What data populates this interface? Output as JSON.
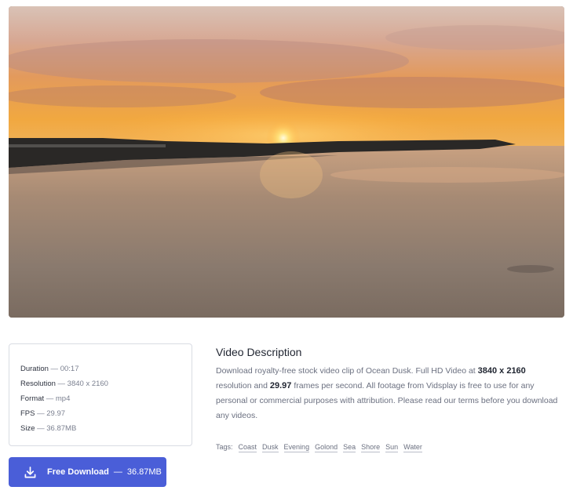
{
  "video": {
    "title": "Ocean Dusk"
  },
  "meta": [
    {
      "key": "Duration",
      "value": "00:17"
    },
    {
      "key": "Resolution",
      "value": "3840 x 2160"
    },
    {
      "key": "Format",
      "value": "mp4"
    },
    {
      "key": "FPS",
      "value": "29.97"
    },
    {
      "key": "Size",
      "value": "36.87MB"
    }
  ],
  "meta_sep": " — ",
  "download": {
    "label": "Free Download",
    "sep": "—",
    "size": "36.87MB"
  },
  "description": {
    "title": "Video Description",
    "part1": "Download royalty-free stock video clip of Ocean Dusk. Full HD Video at ",
    "resolution": "3840 x 2160",
    "part2": " resolution and ",
    "fps": "29.97",
    "part3": " frames per second. All footage from Vidsplay is free to use for any personal or commercial purposes with attribution. Please read our terms before you download any videos."
  },
  "tags": {
    "label": "Tags:",
    "items": [
      "Coast",
      "Dusk",
      "Evening",
      "Golond",
      "Sea",
      "Shore",
      "Sun",
      "Water"
    ]
  },
  "colors": {
    "button": "#4a5ed8",
    "card_border": "#d9dce3"
  }
}
